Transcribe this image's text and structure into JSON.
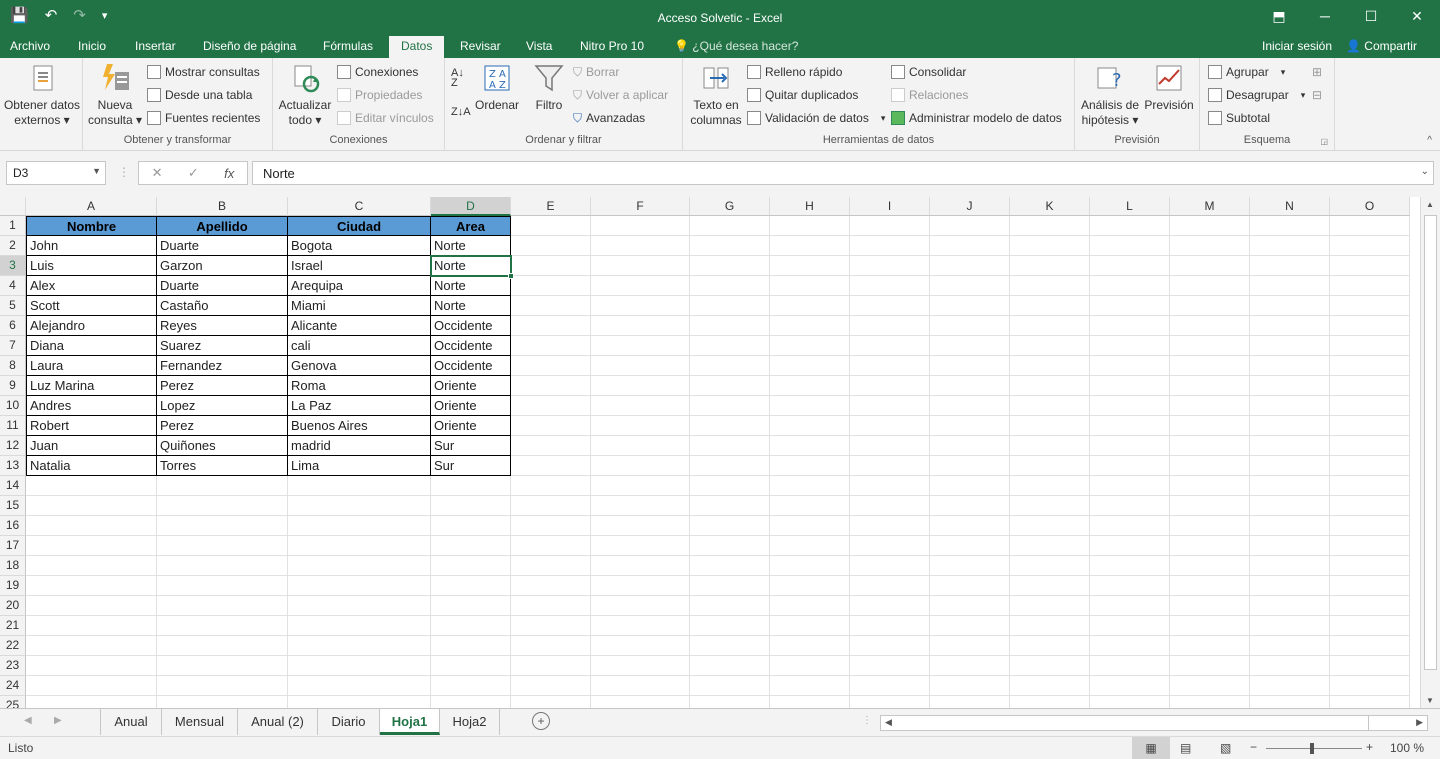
{
  "window": {
    "title": "Acceso Solvetic - Excel"
  },
  "qat": {
    "save_icon": "💾",
    "undo_icon": "↶",
    "redo_icon": "↷",
    "customize_icon": "▾"
  },
  "tabs": [
    "Archivo",
    "Inicio",
    "Insertar",
    "Diseño de página",
    "Fórmulas",
    "Datos",
    "Revisar",
    "Vista",
    "Nitro Pro 10"
  ],
  "tell_me": "¿Qué desea hacer?",
  "signin": "Iniciar sesión",
  "share": "Compartir",
  "ribbon": {
    "get_external": "Obtener datos externos",
    "new_query": "Nueva consulta",
    "show_queries": "Mostrar consultas",
    "from_table": "Desde una tabla",
    "recent_sources": "Fuentes recientes",
    "group_transform": "Obtener y transformar",
    "refresh_all": "Actualizar todo",
    "connections": "Conexiones",
    "properties": "Propiedades",
    "edit_links": "Editar vínculos",
    "group_connections": "Conexiones",
    "sort": "Ordenar",
    "filter": "Filtro",
    "clear": "Borrar",
    "reapply": "Volver a aplicar",
    "advanced": "Avanzadas",
    "group_sort": "Ordenar y filtrar",
    "text_to_columns": "Texto en columnas",
    "flash_fill": "Relleno rápido",
    "remove_duplicates": "Quitar duplicados",
    "data_validation": "Validación de datos",
    "consolidate": "Consolidar",
    "relationships": "Relaciones",
    "manage_model": "Administrar modelo de datos",
    "group_tools": "Herramientas de datos",
    "what_if": "Análisis de hipótesis",
    "forecast": "Previsión",
    "group_forecast": "Previsión",
    "group_btn": "Agrupar",
    "ungroup": "Desagrupar",
    "subtotal": "Subtotal",
    "group_outline": "Esquema"
  },
  "formula_bar": {
    "name_box": "D3",
    "value": "Norte",
    "fx": "fx"
  },
  "columns": [
    "A",
    "B",
    "C",
    "D",
    "E",
    "F",
    "G",
    "H",
    "I",
    "J",
    "K",
    "L",
    "M",
    "N",
    "O"
  ],
  "rows": [
    "1",
    "2",
    "3",
    "4",
    "5",
    "6",
    "7",
    "8",
    "9",
    "10",
    "11",
    "12",
    "13",
    "14",
    "15",
    "16",
    "17",
    "18",
    "19",
    "20",
    "21",
    "22",
    "23",
    "24",
    "25"
  ],
  "table": {
    "headers": [
      "Nombre",
      "Apellido",
      "Ciudad",
      "Area"
    ],
    "rows": [
      [
        "John",
        "Duarte",
        "Bogota",
        "Norte"
      ],
      [
        "Luis",
        "Garzon",
        "Israel",
        "Norte"
      ],
      [
        "Alex",
        "Duarte",
        "Arequipa",
        "Norte"
      ],
      [
        "Scott",
        "Castaño",
        "Miami",
        "Norte"
      ],
      [
        "Alejandro",
        "Reyes",
        "Alicante",
        "Occidente"
      ],
      [
        "Diana",
        "Suarez",
        "cali",
        "Occidente"
      ],
      [
        "Laura",
        "Fernandez",
        "Genova",
        "Occidente"
      ],
      [
        "Luz Marina",
        "Perez",
        "Roma",
        "Oriente"
      ],
      [
        "Andres",
        "Lopez",
        "La Paz",
        "Oriente"
      ],
      [
        "Robert",
        "Perez",
        "Buenos Aires",
        "Oriente"
      ],
      [
        "Juan",
        "Quiñones",
        "madrid",
        "Sur"
      ],
      [
        "Natalia",
        "Torres",
        "Lima",
        "Sur"
      ]
    ]
  },
  "sheets": [
    "Anual",
    "Mensual",
    "Anual (2)",
    "Diario",
    "Hoja1",
    "Hoja2"
  ],
  "active_sheet": "Hoja1",
  "status": {
    "ready": "Listo",
    "zoom": "100 %"
  },
  "colors": {
    "accent": "#217346",
    "header_fill": "#5b9bd5"
  }
}
